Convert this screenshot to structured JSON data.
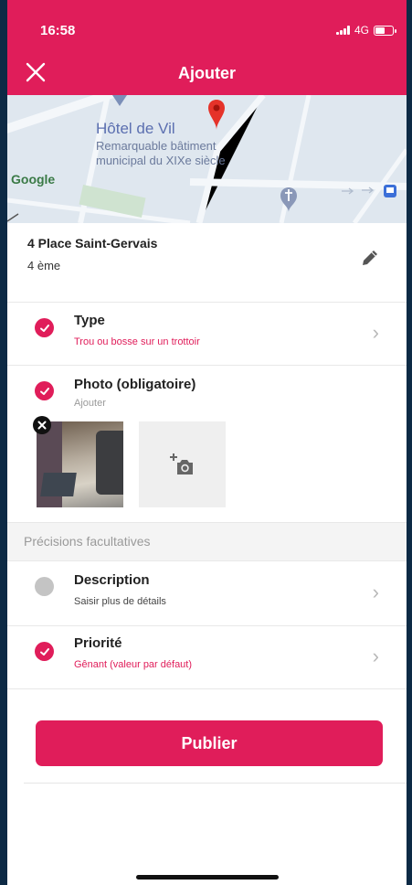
{
  "status_bar": {
    "time": "16:58",
    "network": "4G"
  },
  "header": {
    "title": "Ajouter",
    "close_icon": "close-icon"
  },
  "map": {
    "poi_name": "Hôtel de Vil",
    "poi_desc_1": "Remarquable bâtiment",
    "poi_desc_2": "municipal du XIXe siècle",
    "provider": "Google"
  },
  "address": {
    "street": "4 Place Saint-Gervais",
    "district": "4 ème",
    "edit_icon": "pencil-icon"
  },
  "type": {
    "title": "Type",
    "value": "Trou ou bosse sur un trottoir",
    "checked": true
  },
  "photo": {
    "title": "Photo (obligatoire)",
    "subtitle": "Ajouter",
    "checked": true,
    "photo_count": 1
  },
  "optional_section": {
    "header": "Précisions facultatives"
  },
  "description": {
    "title": "Description",
    "subtitle": "Saisir plus de détails",
    "checked": false
  },
  "priority": {
    "title": "Priorité",
    "value": "Gênant (valeur par défaut)",
    "checked": true
  },
  "actions": {
    "publish_label": "Publier"
  },
  "colors": {
    "accent": "#e01d5a",
    "background": "#0d2a45",
    "unchecked": "#c4c4c4"
  }
}
